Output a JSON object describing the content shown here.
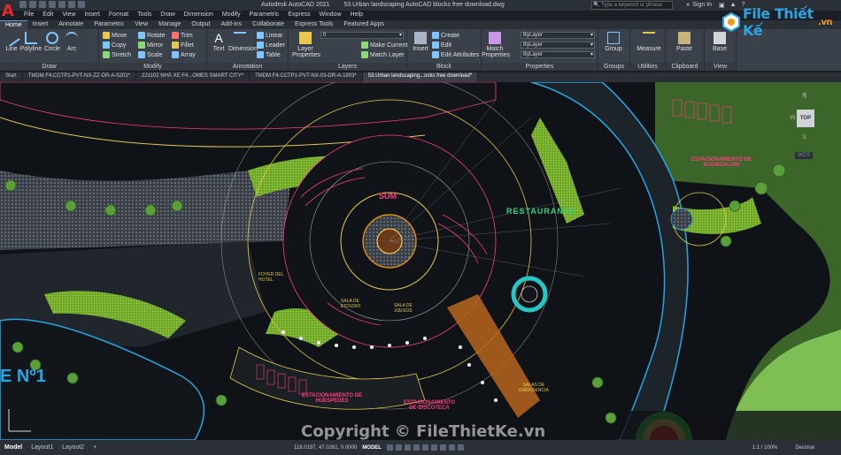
{
  "app": {
    "title": "Autodesk AutoCAD 2021",
    "file": "53.Urban landscaping AutoCAD blocks free download.dwg",
    "search_placeholder": "Type a keyword or phrase",
    "signin": "Sign In"
  },
  "menu": [
    "File",
    "Edit",
    "View",
    "Insert",
    "Format",
    "Tools",
    "Draw",
    "Dimension",
    "Modify",
    "Parametric",
    "Express",
    "Window",
    "Help"
  ],
  "ribbon_tabs": [
    "Home",
    "Insert",
    "Annotate",
    "Parametric",
    "View",
    "Manage",
    "Output",
    "Add-ins",
    "Collaborate",
    "Express Tools",
    "Featured Apps"
  ],
  "ribbon": {
    "draw": {
      "label": "Draw",
      "tools": [
        "Line",
        "Polyline",
        "Circle",
        "Arc"
      ]
    },
    "modify": {
      "label": "Modify",
      "tools": [
        "Move",
        "Rotate",
        "Trim",
        "Copy",
        "Mirror",
        "Fillet",
        "Stretch",
        "Scale",
        "Array"
      ]
    },
    "annotation": {
      "label": "Annotation",
      "tools": [
        "Text",
        "Dimension",
        "Linear",
        "Leader",
        "Table"
      ]
    },
    "layers": {
      "label": "Layers",
      "tools": [
        "Layer Properties",
        "Make Current",
        "Match Layer"
      ],
      "current_layer": "0"
    },
    "block": {
      "label": "Block",
      "tools": [
        "Insert",
        "Create",
        "Edit",
        "Edit Attributes"
      ]
    },
    "properties": {
      "label": "Properties",
      "tools": [
        "Match Properties"
      ],
      "color": "ByLayer",
      "linetype": "ByLayer",
      "lineweight": "ByLayer"
    },
    "groups": {
      "label": "Groups",
      "tools": [
        "Group"
      ]
    },
    "utilities": {
      "label": "Utilities",
      "tools": [
        "Measure"
      ]
    },
    "clipboard": {
      "label": "Clipboard",
      "tools": [
        "Paste"
      ]
    },
    "view": {
      "label": "View",
      "tools": [
        "Base"
      ]
    }
  },
  "doc_tabs": [
    "Start",
    "TMDM.F4.CCTP1-PVT-NX-ZZ-DR-A-5201*",
    "221102 NHÀ XE F4...OMES SMART CITY*",
    "TMDM.F4.CCTP1-PVT-NX-03-DR-A-1803*",
    "53.Urban landscaping...ocks free download*"
  ],
  "viewcube": {
    "n": "N",
    "w": "W",
    "s": "S",
    "top": "TOP",
    "wcs": "WCS"
  },
  "drawing_labels": {
    "sum": "SUM",
    "restaurante": "RESTAURANTE",
    "bungalow": "ESTACIONAMIENTO DE BOUNGALOW",
    "huespedes": "ESTACIONAMIENTO DE HUESPEDES",
    "discoteca": "ESTACIONAMIENTO DE DISCOTECA",
    "salas": "SALAS DE EMERGENCIA",
    "sala_est": "SALA DE ESTUDIO",
    "sala_juegos": "SALA DE JUEGOS",
    "foyer": "FOYER DEL HOTEL",
    "number": "E Nº1"
  },
  "brand": {
    "text": "File Thiết Kế",
    "suffix": ".vn"
  },
  "watermark": "Copyright © FileThietKe.vn",
  "layout_tabs": [
    "Model",
    "Layout1",
    "Layout2",
    "+"
  ],
  "status": {
    "coords": "118.0197, 47.0261, 0.0000",
    "mode": "MODEL",
    "scale": "1:1 / 100%",
    "units": "Decimal"
  }
}
